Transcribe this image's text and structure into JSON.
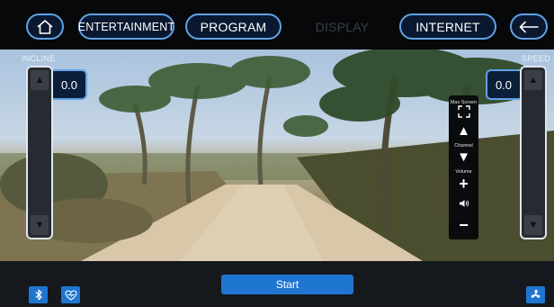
{
  "nav": {
    "entertainment": "ENTERTAINMENT",
    "program": "PROGRAM",
    "display": "DISPLAY",
    "internet": "INTERNET"
  },
  "incline": {
    "label": "INCLINE",
    "value": "0.0"
  },
  "speed": {
    "label": "SPEED",
    "value": "0.0"
  },
  "media": {
    "max_screen": "Max Screen",
    "channel": "Channel",
    "volume": "Volume"
  },
  "footer": {
    "start": "Start"
  },
  "colors": {
    "accent": "#5fa3e6",
    "primary_button": "#1f76d1",
    "topbar": "#07080a"
  },
  "icons": [
    "home-icon",
    "back-arrow-icon",
    "fullscreen-icon",
    "triangle-up-icon",
    "triangle-down-icon",
    "plus-icon",
    "speaker-icon",
    "minus-icon",
    "bluetooth-icon",
    "heart-rate-icon",
    "fan-icon"
  ]
}
